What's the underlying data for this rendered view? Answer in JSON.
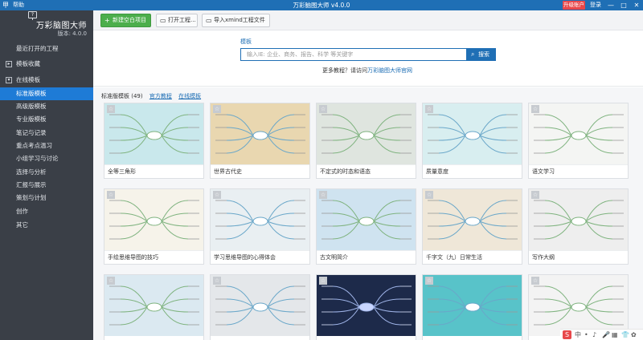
{
  "titlebar": {
    "app_icon": "甲",
    "help_label": "帮助",
    "title": "万彩脑图大师 v4.0.0",
    "upgrade_label": "升级账户",
    "login_label": "登录",
    "minimize_icon": "—",
    "maximize_icon": "□",
    "close_icon": "✕"
  },
  "sidebar": {
    "logo_box_text": "?",
    "app_name": "万彩脑图大师",
    "version": "版本: 4.0.0",
    "items": [
      {
        "label": "最近打开的工程",
        "type": "item"
      },
      {
        "label": "模板收藏",
        "type": "group",
        "expander": "▸"
      },
      {
        "label": "在线模板",
        "type": "group",
        "expander": "▾"
      },
      {
        "label": "标准版模板",
        "type": "sub",
        "active": true
      },
      {
        "label": "高级版模板",
        "type": "sub"
      },
      {
        "label": "专业版模板",
        "type": "sub"
      },
      {
        "label": "笔记与记录",
        "type": "sub"
      },
      {
        "label": "重点考点温习",
        "type": "sub"
      },
      {
        "label": "小组学习与讨论",
        "type": "sub"
      },
      {
        "label": "选择与分析",
        "type": "sub"
      },
      {
        "label": "汇报与展示",
        "type": "sub"
      },
      {
        "label": "策划与计划",
        "type": "sub"
      },
      {
        "label": "创作",
        "type": "sub"
      },
      {
        "label": "其它",
        "type": "sub"
      }
    ]
  },
  "toolbar": {
    "new_label": "新建空白项目",
    "open_label": "打开工程...",
    "import_label": "导入xmind工程文件"
  },
  "search": {
    "label": "模板",
    "placeholder": "输入IE: 企业、商务、报告、科学 等关键字",
    "button_label": "搜索",
    "more_text": "更多教程？请访问",
    "more_link": "万彩脑图大师官网"
  },
  "templates": {
    "heading": "标准版模板 (49)",
    "link_official": "官方教程",
    "link_online": "在线模板",
    "cards": [
      {
        "caption": "全等三角形",
        "bg": "#c9e8ec"
      },
      {
        "caption": "世界古代史",
        "bg": "#e9d7b0"
      },
      {
        "caption": "不定式的时态和语态",
        "bg": "#dfe5df"
      },
      {
        "caption": "质量意度",
        "bg": "#d8eef0"
      },
      {
        "caption": "语文学习",
        "bg": "#f4f5f3"
      },
      {
        "caption": "手绘思维导图的技巧",
        "bg": "#f6f3ea"
      },
      {
        "caption": "学习思维导图的心得体会",
        "bg": "#e9eff2"
      },
      {
        "caption": "古文明简介",
        "bg": "#cfe3f0"
      },
      {
        "caption": "千字文（九）日常生活",
        "bg": "#efe7d8"
      },
      {
        "caption": "写作大纲",
        "bg": "#eeeeee"
      },
      {
        "caption": "",
        "bg": "#dbe9f1"
      },
      {
        "caption": "",
        "bg": "#e4e7ea"
      },
      {
        "caption": "",
        "bg": "#1d2a4a"
      },
      {
        "caption": "",
        "bg": "#58c3c9"
      },
      {
        "caption": "",
        "bg": "#f3f3f3"
      }
    ]
  },
  "tray": {
    "items": [
      "S",
      "中",
      "•",
      "♪",
      "🎤",
      "▦",
      "👕",
      "✿"
    ]
  }
}
